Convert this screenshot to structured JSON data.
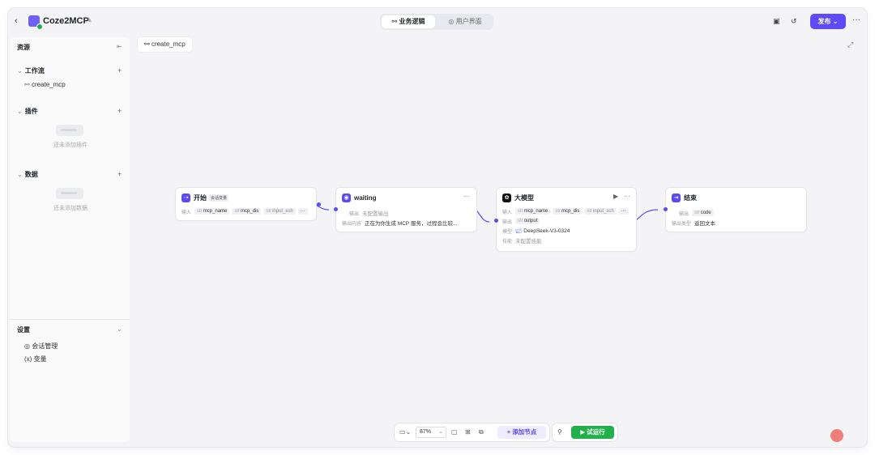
{
  "window": {
    "app_title": "Coze2MCP",
    "mode_tabs": [
      "业务逻辑",
      "用户界面"
    ],
    "publish_label": "发布"
  },
  "sidebar": {
    "header": "资源",
    "sections": [
      {
        "title": "工作流",
        "items": [
          "create_mcp"
        ]
      },
      {
        "title": "插件",
        "empty_text": "还未添加插件"
      },
      {
        "title": "数据",
        "empty_text": "还未添加数据"
      }
    ],
    "settings": {
      "title": "设置",
      "items": [
        "会话管理",
        "变量"
      ]
    }
  },
  "canvas": {
    "tab": "create_mcp",
    "nodes": {
      "start": {
        "title": "开始",
        "tag": "会话变量",
        "input_label": "输入",
        "inputs": [
          "mcp_name",
          "mcp_dis",
          "input_sch"
        ],
        "input_type": "str"
      },
      "waiting": {
        "title": "waiting",
        "output_label": "输出",
        "output_value": "未配置输出",
        "content_label": "输出内容",
        "content_value": "正在为你生成 MCP 服务，过程会比较..."
      },
      "llm": {
        "title": "大模型",
        "input_label": "输入",
        "inputs": [
          "mcp_name",
          "mcp_dis",
          "input_sch"
        ],
        "output_label": "输出",
        "output": "output",
        "model_label": "模型",
        "model": "DeepSeek-V3-0324",
        "skill_label": "技能",
        "skill_value": "未配置技能"
      },
      "end": {
        "title": "结束",
        "output_label": "输出",
        "output": "code",
        "type_label": "输出类型",
        "type_value": "返回文本"
      }
    }
  },
  "toolbar": {
    "zoom": "87%",
    "add_node": "添加节点",
    "run": "试运行"
  },
  "colors": {
    "accent": "#5f4bf6",
    "run_green": "#22b04b",
    "start_icon": "#5a4cf0",
    "end_icon": "#5a4cf0",
    "llm_icon": "#111111"
  }
}
